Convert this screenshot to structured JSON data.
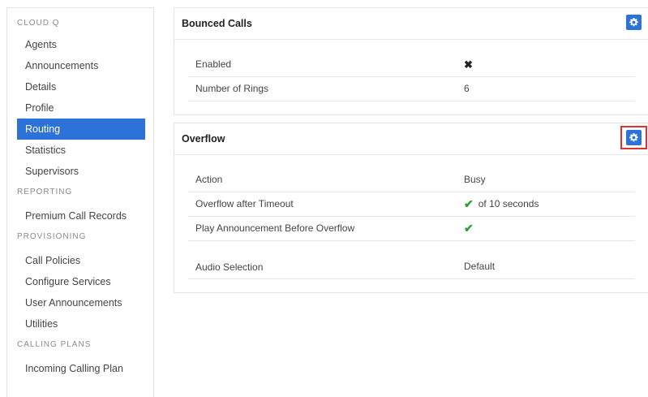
{
  "sidebar": {
    "sections": [
      {
        "title": "CLOUD Q",
        "items": [
          "Agents",
          "Announcements",
          "Details",
          "Profile",
          "Routing",
          "Statistics",
          "Supervisors"
        ]
      },
      {
        "title": "REPORTING",
        "items": [
          "Premium Call Records"
        ]
      },
      {
        "title": "PROVISIONING",
        "items": [
          "Call Policies",
          "Configure Services",
          "User Announcements",
          "Utilities"
        ]
      },
      {
        "title": "CALLING PLANS",
        "items": [
          "Incoming Calling Plan"
        ]
      }
    ],
    "active_item": "Routing"
  },
  "bounced_calls": {
    "title": "Bounced Calls",
    "rows": [
      {
        "label": "Enabled",
        "value": "✖"
      },
      {
        "label": "Number of Rings",
        "value": "6"
      }
    ]
  },
  "overflow": {
    "title": "Overflow",
    "rows": [
      {
        "label": "Action",
        "value": "Busy"
      },
      {
        "label": "Overflow after Timeout",
        "check": "✔",
        "value": "of 10 seconds"
      },
      {
        "label": "Play Announcement Before Overflow",
        "check": "✔",
        "value": ""
      },
      {
        "label": "Audio Selection",
        "value": "Default"
      }
    ]
  },
  "colors": {
    "accent": "#2d72d9",
    "check": "#2e9e3e",
    "highlight": "#e0312f"
  }
}
